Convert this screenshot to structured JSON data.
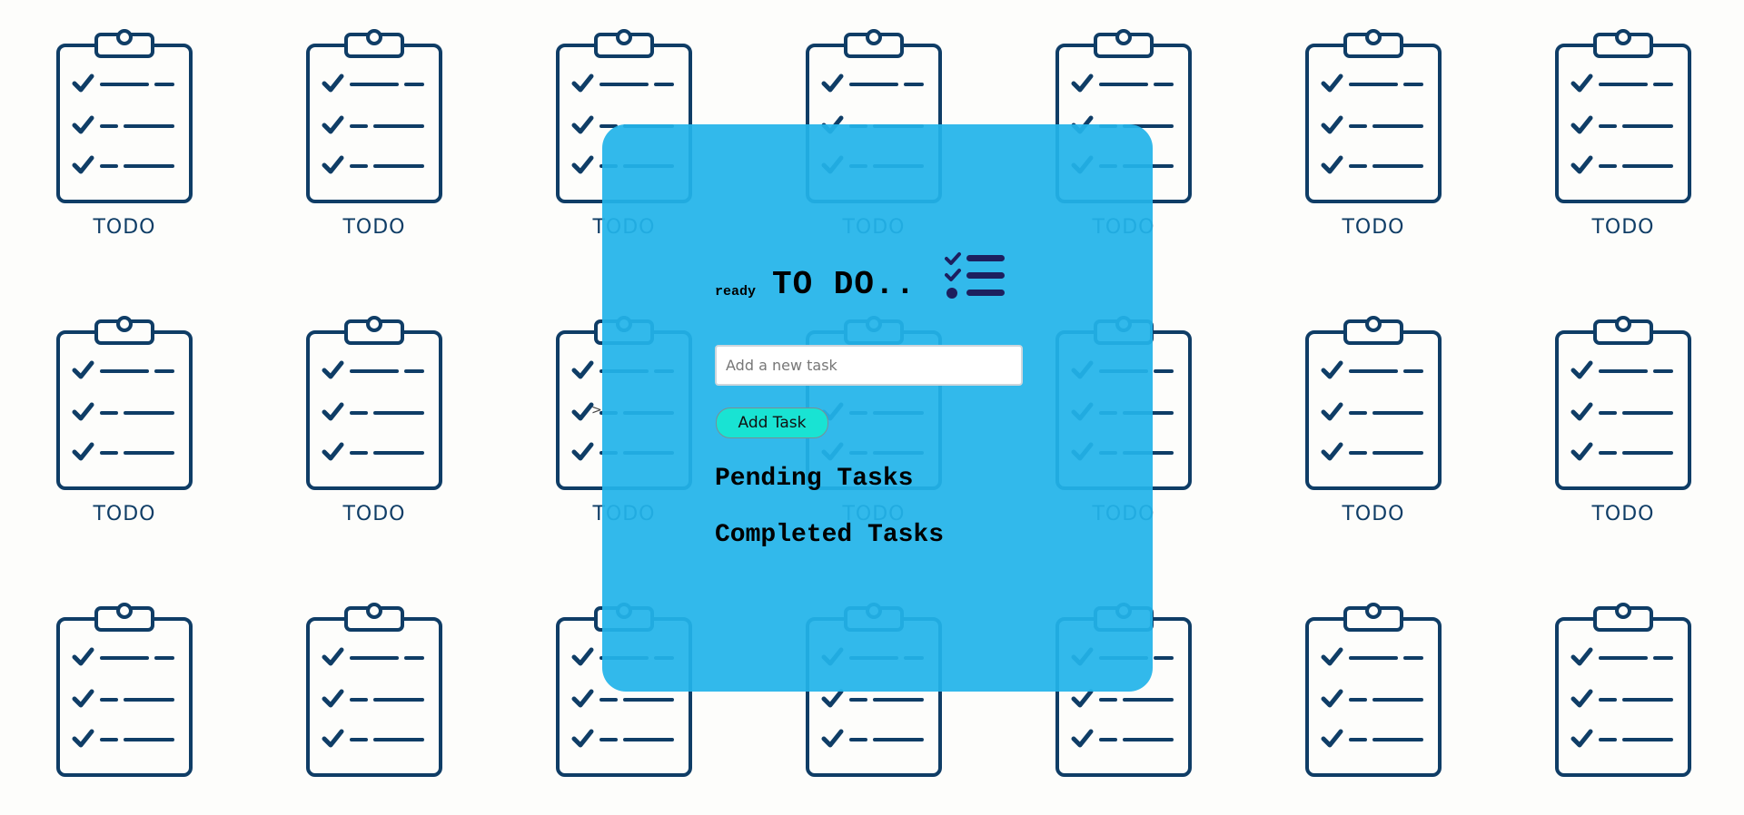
{
  "background": {
    "tile_label": "TODO",
    "tile_icon": "clipboard-checklist-icon",
    "tile_color": "#0f3d66"
  },
  "card": {
    "title_prefix": "ready",
    "title": "TO DO..",
    "title_icon": "checklist-icon",
    "input_placeholder": "Add a new task",
    "input_value": "",
    "add_button_label": "Add Task",
    "pending_heading": "Pending Tasks",
    "completed_heading": "Completed Tasks",
    "pending_tasks": [],
    "completed_tasks": [],
    "colors": {
      "card_bg": "#22b4ea",
      "button_bg": "#19e3d3",
      "icon": "#1d1f5e"
    }
  },
  "cursor_glyph": ">"
}
